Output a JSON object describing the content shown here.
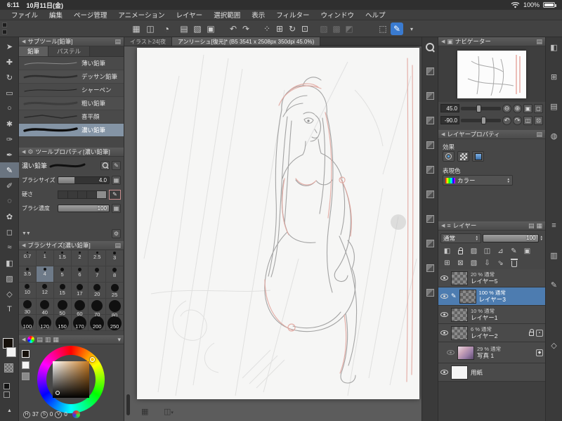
{
  "status_bar": {
    "time": "6:11",
    "date": "10月11日(金)",
    "battery_percent": "100%"
  },
  "menu_bar": {
    "items": [
      "ファイル",
      "編集",
      "ページ管理",
      "アニメーション",
      "レイヤー",
      "選択範囲",
      "表示",
      "フィルター",
      "ウィンドウ",
      "ヘルプ"
    ]
  },
  "toolbar": {
    "icons": [
      "workspace-grid-icon",
      "screen-share-icon",
      "clip-studio-icon",
      "new-canvas-icon",
      "open-file-icon",
      "save-file-icon",
      "undo-icon",
      "redo-icon",
      "snap-dots-icon",
      "snap-grid-icon",
      "rotate-reset-icon",
      "crop-icon",
      "transform-disabled-icon",
      "mesh-disabled-icon",
      "frame-disabled-icon",
      "selection-launcher-icon",
      "stylus-active-icon",
      "toolbar-more-icon"
    ]
  },
  "tools": {
    "icons": [
      "object-tool",
      "move-tool",
      "rotate-view-tool",
      "marquee-tool",
      "lasso-tool",
      "auto-select-tool",
      "eyedropper-tool",
      "pen-tool",
      "pencil-tool",
      "brush-tool",
      "airbrush-tool",
      "decoration-tool",
      "eraser-tool",
      "blend-tool",
      "fill-tool",
      "gradient-tool",
      "figure-tool",
      "text-tool"
    ],
    "selected": "pencil-tool"
  },
  "doc_tabs": {
    "tab1": "イラスト24[夜",
    "tab2": "アンリーシュ[復元]* (B5 3541 x 2508px 350dpi 45.0%)"
  },
  "subtool": {
    "title": "サブツール[鉛筆]",
    "tabs": [
      "鉛筆",
      "パステル"
    ],
    "items": [
      "薄い鉛筆",
      "デッサン鉛筆",
      "シャーペン",
      "粗い鉛筆",
      "喜平顔",
      "濃い鉛筆"
    ],
    "selected": "濃い鉛筆"
  },
  "tool_property": {
    "title": "ツールプロパティ[濃い鉛筆]",
    "subtool_name": "濃い鉛筆",
    "params": [
      {
        "label": "ブラシサイズ",
        "value": "4.0"
      },
      {
        "label": "硬さ",
        "value": ""
      },
      {
        "label": "ブラシ濃度",
        "value": "100"
      }
    ]
  },
  "brush_size_panel": {
    "title": "ブラシサイズ[濃い鉛筆]",
    "selected": "4",
    "values": [
      "0.7",
      "1",
      "1.5",
      "2",
      "2.5",
      "3",
      "3.5",
      "4",
      "5",
      "6",
      "7",
      "8",
      "10",
      "12",
      "15",
      "17",
      "20",
      "25",
      "30",
      "40",
      "50",
      "60",
      "70",
      "80",
      "100",
      "120",
      "150",
      "170",
      "200",
      "250"
    ]
  },
  "color_panel": {
    "readouts": [
      {
        "label": "H",
        "value": "37"
      },
      {
        "label": "S",
        "value": "0"
      },
      {
        "label": "V",
        "value": "0"
      }
    ]
  },
  "navigator": {
    "title": "ナビゲーター",
    "zoom": "45.0",
    "rotation": "-90.0"
  },
  "layer_property": {
    "title": "レイヤープロパティ",
    "effect_label": "効果",
    "color_mode_label": "表現色",
    "color_mode_value": "カラー"
  },
  "layer_panel": {
    "title": "レイヤー",
    "blend_mode": "通常",
    "opacity": "100",
    "layers": [
      {
        "meta": "20 % 通常",
        "name": "レイヤー5"
      },
      {
        "meta": "100 % 通常",
        "name": "レイヤー3",
        "selected": true
      },
      {
        "meta": "10 % 通常",
        "name": "レイヤー1"
      },
      {
        "meta": "6 % 通常",
        "name": "レイヤー2"
      },
      {
        "meta": "29 % 通常",
        "name": "写真 1"
      },
      {
        "meta": "",
        "name": "用紙"
      }
    ]
  },
  "dock_left": {
    "icons": [
      "zoom-dock-icon",
      "material-dock-1",
      "material-dock-2",
      "material-dock-3",
      "material-dock-4",
      "material-dock-5",
      "material-dock-6",
      "material-dock-7",
      "material-dock-8",
      "material-dock-9",
      "material-dock-10"
    ]
  },
  "dock_right": {
    "icons": [
      "panel-dock-1",
      "panel-dock-2",
      "panel-dock-3",
      "panel-dock-4",
      "panel-dock-5",
      "panel-dock-6",
      "panel-dock-7",
      "panel-dock-8"
    ]
  }
}
